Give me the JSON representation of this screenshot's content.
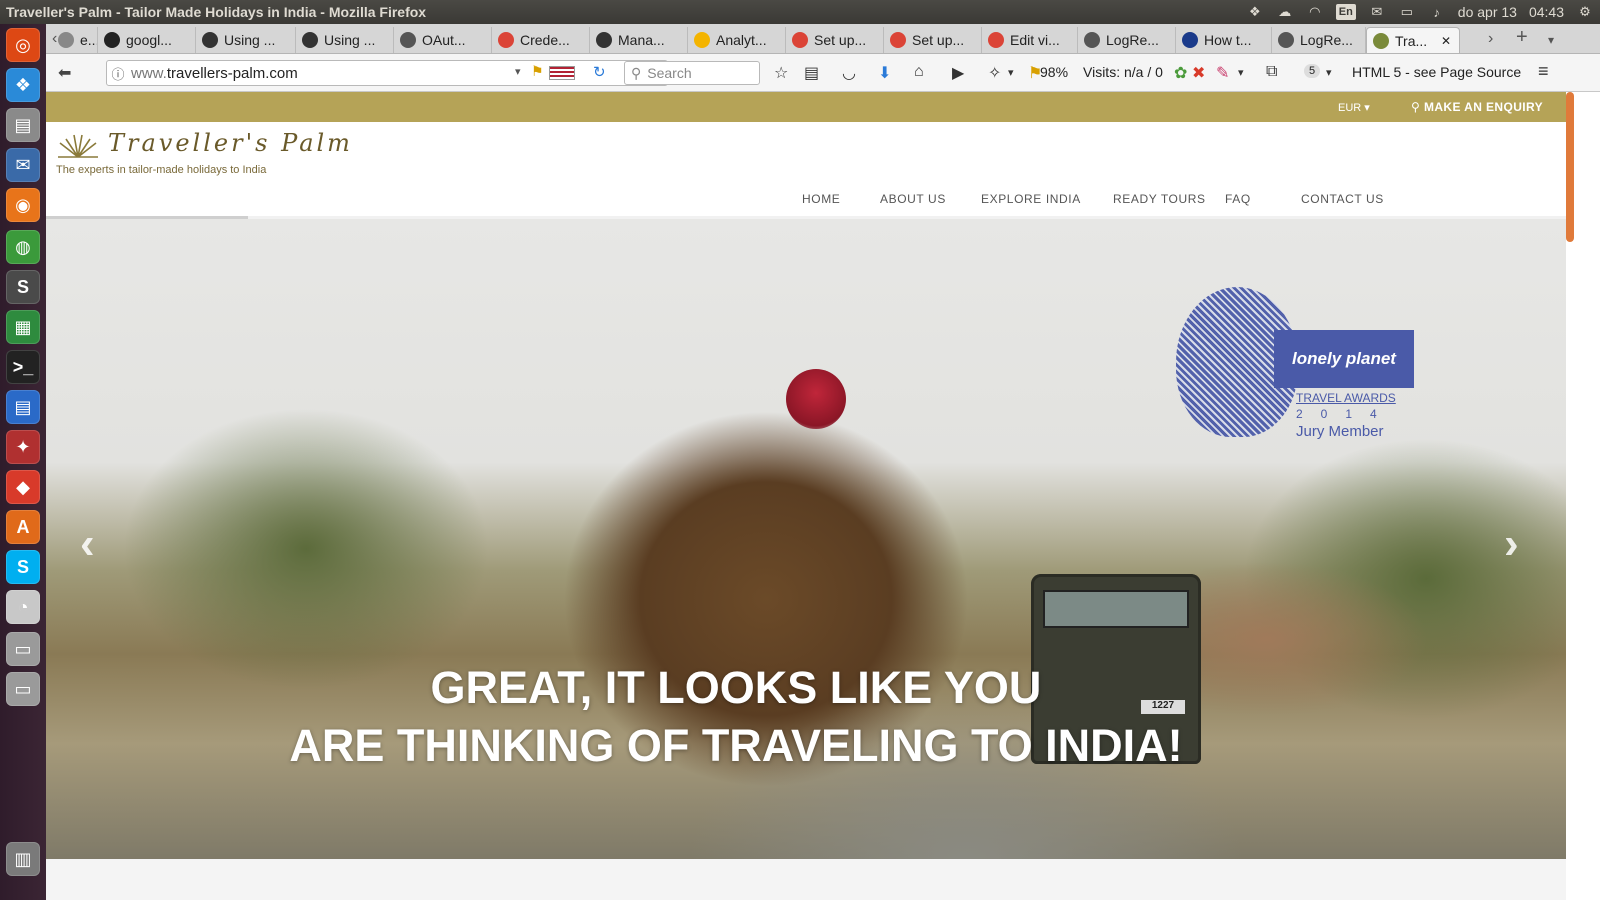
{
  "window": {
    "title": "Traveller's Palm - Tailor Made Holidays in India - Mozilla Firefox",
    "tray": {
      "language": "En",
      "date": "do apr 13",
      "time": "04:43"
    }
  },
  "browser": {
    "tabs": [
      {
        "label": "e...",
        "icon": "page-icon",
        "color": "#888888"
      },
      {
        "label": "googl...",
        "icon": "github-icon",
        "color": "#222222"
      },
      {
        "label": "Using ...",
        "icon": "page-icon",
        "color": "#333333"
      },
      {
        "label": "Using ...",
        "icon": "page-icon",
        "color": "#333333"
      },
      {
        "label": "OAut...",
        "icon": "oauth-icon",
        "color": "#555555"
      },
      {
        "label": "Crede...",
        "icon": "google-icon",
        "color": "#db4437"
      },
      {
        "label": "Mana...",
        "icon": "page-icon",
        "color": "#333333"
      },
      {
        "label": "Analyt...",
        "icon": "analytics-icon",
        "color": "#f4b400"
      },
      {
        "label": "Set up...",
        "icon": "google-icon",
        "color": "#db4437"
      },
      {
        "label": "Set up...",
        "icon": "google-icon",
        "color": "#db4437"
      },
      {
        "label": "Edit vi...",
        "icon": "google-icon",
        "color": "#db4437"
      },
      {
        "label": "LogRe...",
        "icon": "logrocket-icon",
        "color": "#555555"
      },
      {
        "label": "How t...",
        "icon": "perl-icon",
        "color": "#1a3a8a"
      },
      {
        "label": "LogRe...",
        "icon": "logrocket-icon",
        "color": "#555555"
      },
      {
        "label": "Tra...",
        "icon": "palm-icon",
        "color": "#7a8a3a",
        "active": true
      }
    ],
    "url_prefix": "www.",
    "url_host": "travellers-palm.com",
    "search_placeholder": "Search",
    "zoom": "98%",
    "visits": "Visits: n/a / 0",
    "badge_count": "5",
    "html_info": "HTML 5 - see Page Source"
  },
  "site": {
    "currency": "EUR",
    "enquiry": "MAKE AN ENQUIRY",
    "logo_text": "Traveller's Palm",
    "tagline": "The experts in tailor-made holidays to India",
    "nav": [
      "HOME",
      "ABOUT US",
      "EXPLORE INDIA",
      "READY TOURS",
      "FAQ",
      "CONTACT US"
    ],
    "award": {
      "brand": "lonely planet",
      "line1": "TRAVEL AWARDS",
      "line2": "2014",
      "line3": "Jury Member"
    },
    "jeep_plate": "1227",
    "headline_line1": "GREAT, IT LOOKS LIKE YOU",
    "headline_line2": "ARE THINKING OF TRAVELING TO INDIA!"
  },
  "colors": {
    "utility_bar": "#b5a357",
    "award_blue": "#4a5aa8"
  }
}
